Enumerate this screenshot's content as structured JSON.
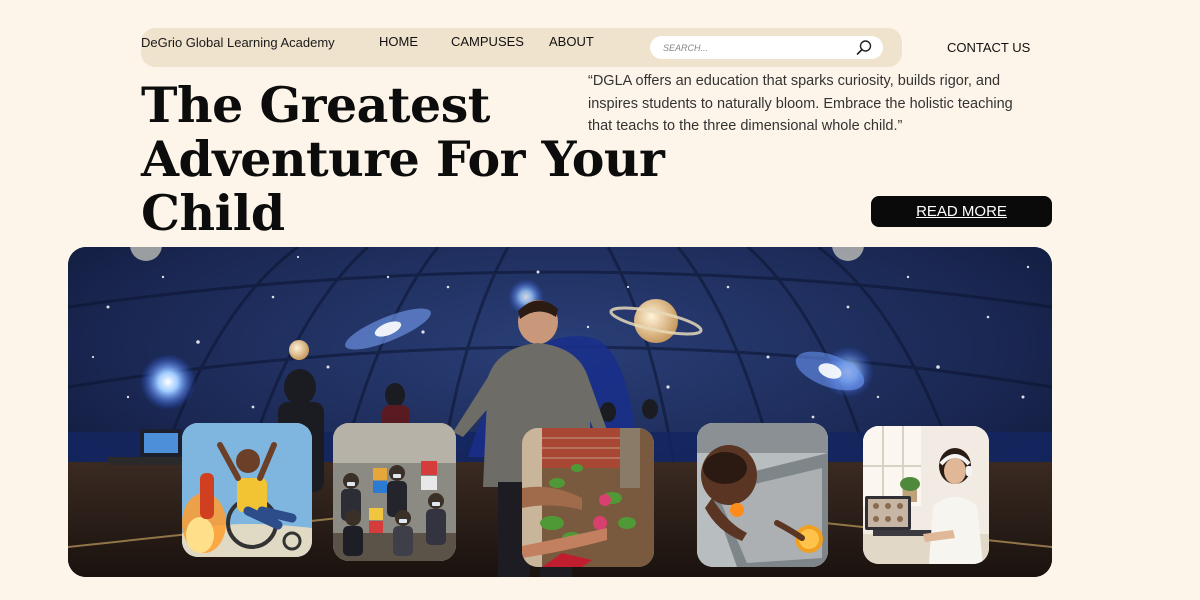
{
  "header": {
    "brand": "DeGrio Global Learning Academy",
    "nav": [
      {
        "label": "HOME"
      },
      {
        "label": "CAMPUSES"
      },
      {
        "label": "ABOUT"
      }
    ],
    "search": {
      "placeholder": "SEARCH..."
    },
    "contact_label": "CONTACT US"
  },
  "hero": {
    "title_lines": [
      "The Greatest",
      "Adventure For Your",
      "Child"
    ],
    "quote": "“DGLA offers an education that sparks curiosity, builds rigor, and inspires students to naturally bloom. Embrace the holistic teaching  that teachs to the three dimensional  whole child.”",
    "button_label": "READ MORE"
  },
  "gallery": [
    {
      "icon": "child-rocket-wheelchair-photo"
    },
    {
      "icon": "students-group-photo"
    },
    {
      "icon": "garden-radish-photo"
    },
    {
      "icon": "baby-sensory-play-photo"
    },
    {
      "icon": "online-learning-photo"
    }
  ],
  "colors": {
    "background": "#fdf5e9",
    "nav_bar": "#f0e3cd",
    "button": "#0a0a0a",
    "dome": "#16203e"
  }
}
